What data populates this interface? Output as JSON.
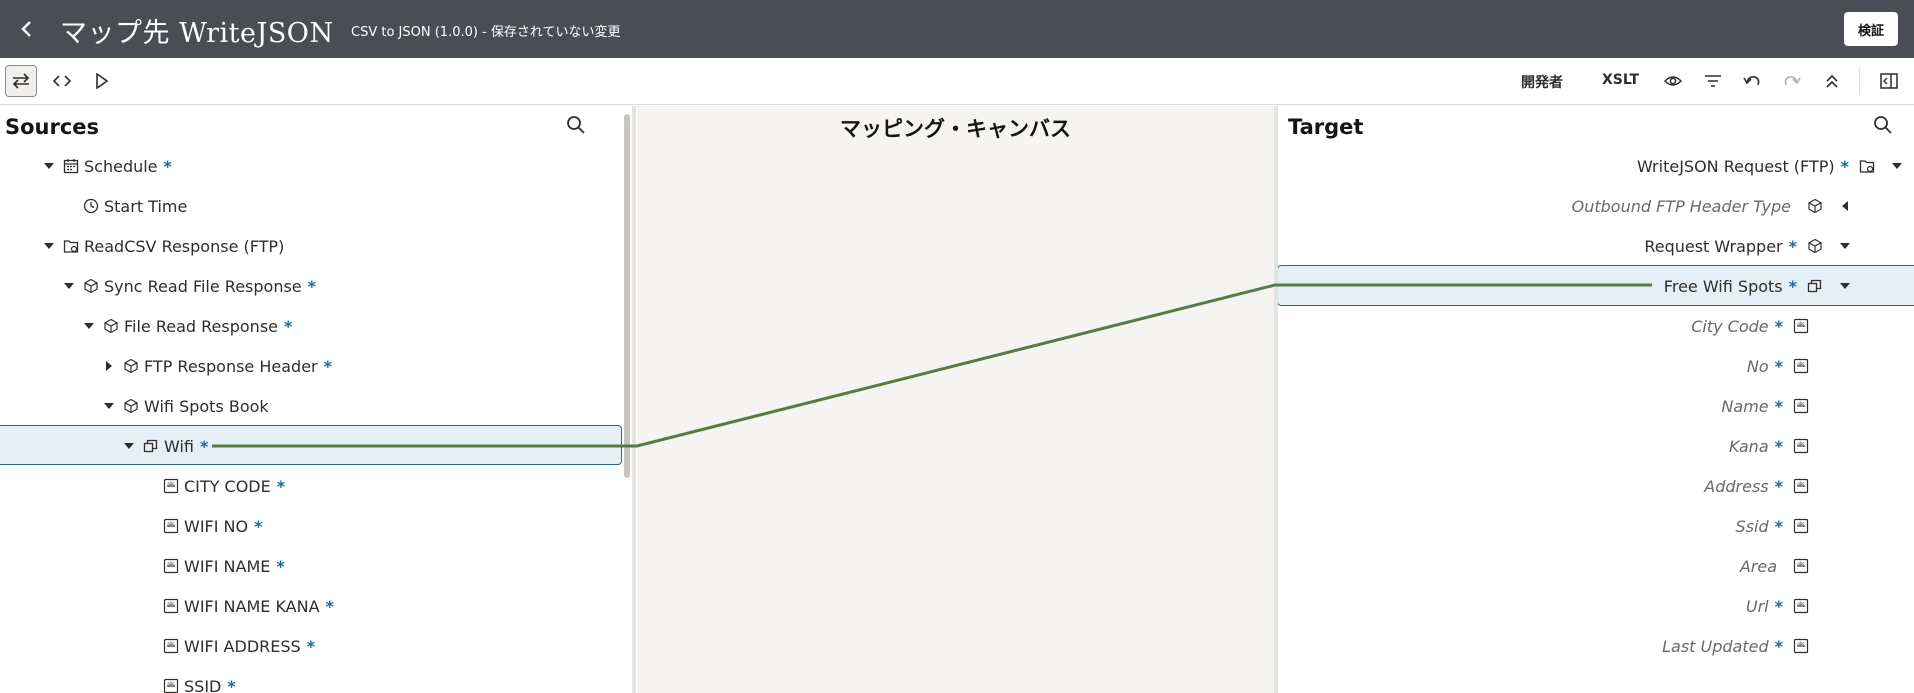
{
  "header": {
    "title": "マップ先 WriteJSON",
    "subtitle": "CSV to JSON (1.0.0) - 保存されていない変更",
    "validate_label": "検証"
  },
  "toolbar": {
    "developer_label": "開発者",
    "xslt_label": "XSLT"
  },
  "sources": {
    "title": "Sources",
    "rows": [
      {
        "label": "Schedule",
        "required": "*",
        "icon": "calendar-icon",
        "caret": "down"
      },
      {
        "label": "Start Time",
        "required": "",
        "icon": "clock-icon",
        "caret": "none"
      },
      {
        "label": "ReadCSV Response (FTP)",
        "required": "",
        "icon": "ftp-folder-icon",
        "caret": "down"
      },
      {
        "label": "Sync Read File Response",
        "required": "*",
        "icon": "cube-icon",
        "caret": "down"
      },
      {
        "label": "File Read Response",
        "required": "*",
        "icon": "cube-icon",
        "caret": "down"
      },
      {
        "label": "FTP Response Header",
        "required": "*",
        "icon": "cube-icon",
        "caret": "right"
      },
      {
        "label": "Wifi Spots Book",
        "required": "",
        "icon": "cube-icon",
        "caret": "down"
      },
      {
        "label": "Wifi",
        "required": "*",
        "icon": "repeating-element-icon",
        "caret": "down"
      },
      {
        "label": "CITY CODE",
        "required": "*",
        "icon": "string-field-icon",
        "caret": "none"
      },
      {
        "label": "WIFI NO",
        "required": "*",
        "icon": "string-field-icon",
        "caret": "none"
      },
      {
        "label": "WIFI NAME",
        "required": "*",
        "icon": "string-field-icon",
        "caret": "none"
      },
      {
        "label": "WIFI NAME KANA",
        "required": "*",
        "icon": "string-field-icon",
        "caret": "none"
      },
      {
        "label": "WIFI ADDRESS",
        "required": "*",
        "icon": "string-field-icon",
        "caret": "none"
      },
      {
        "label": "SSID",
        "required": "*",
        "icon": "string-field-icon",
        "caret": "none"
      }
    ]
  },
  "canvas": {
    "title": "マッピング・キャンバス"
  },
  "target": {
    "title": "Target",
    "rows": [
      {
        "label": "WriteJSON Request (FTP)",
        "required": "*",
        "icon": "ftp-folder-icon",
        "caret": "down"
      },
      {
        "label": "Outbound FTP Header Type",
        "required": "",
        "icon": "cube-icon",
        "caret": "left"
      },
      {
        "label": "Request Wrapper",
        "required": "*",
        "icon": "cube-icon",
        "caret": "down"
      },
      {
        "label": "Free Wifi Spots",
        "required": "*",
        "icon": "repeating-element-icon",
        "caret": "down"
      },
      {
        "label": "City Code",
        "required": "*",
        "icon": "string-field-icon",
        "caret": "none"
      },
      {
        "label": "No",
        "required": "*",
        "icon": "string-field-icon",
        "caret": "none"
      },
      {
        "label": "Name",
        "required": "*",
        "icon": "string-field-icon",
        "caret": "none"
      },
      {
        "label": "Kana",
        "required": "*",
        "icon": "string-field-icon",
        "caret": "none"
      },
      {
        "label": "Address",
        "required": "*",
        "icon": "string-field-icon",
        "caret": "none"
      },
      {
        "label": "Ssid",
        "required": "*",
        "icon": "string-field-icon",
        "caret": "none"
      },
      {
        "label": "Area",
        "required": "",
        "icon": "string-field-icon",
        "caret": "none"
      },
      {
        "label": "Url",
        "required": "*",
        "icon": "string-field-icon",
        "caret": "none"
      },
      {
        "label": "Last Updated",
        "required": "*",
        "icon": "string-field-icon",
        "caret": "none"
      }
    ]
  },
  "colors": {
    "header_bg": "#4a4e54",
    "mapping_line": "#5a7a43",
    "selection_bg": "#e4f0f6",
    "selection_border": "#226a8a",
    "required_asterisk": "#0a6fa6"
  }
}
